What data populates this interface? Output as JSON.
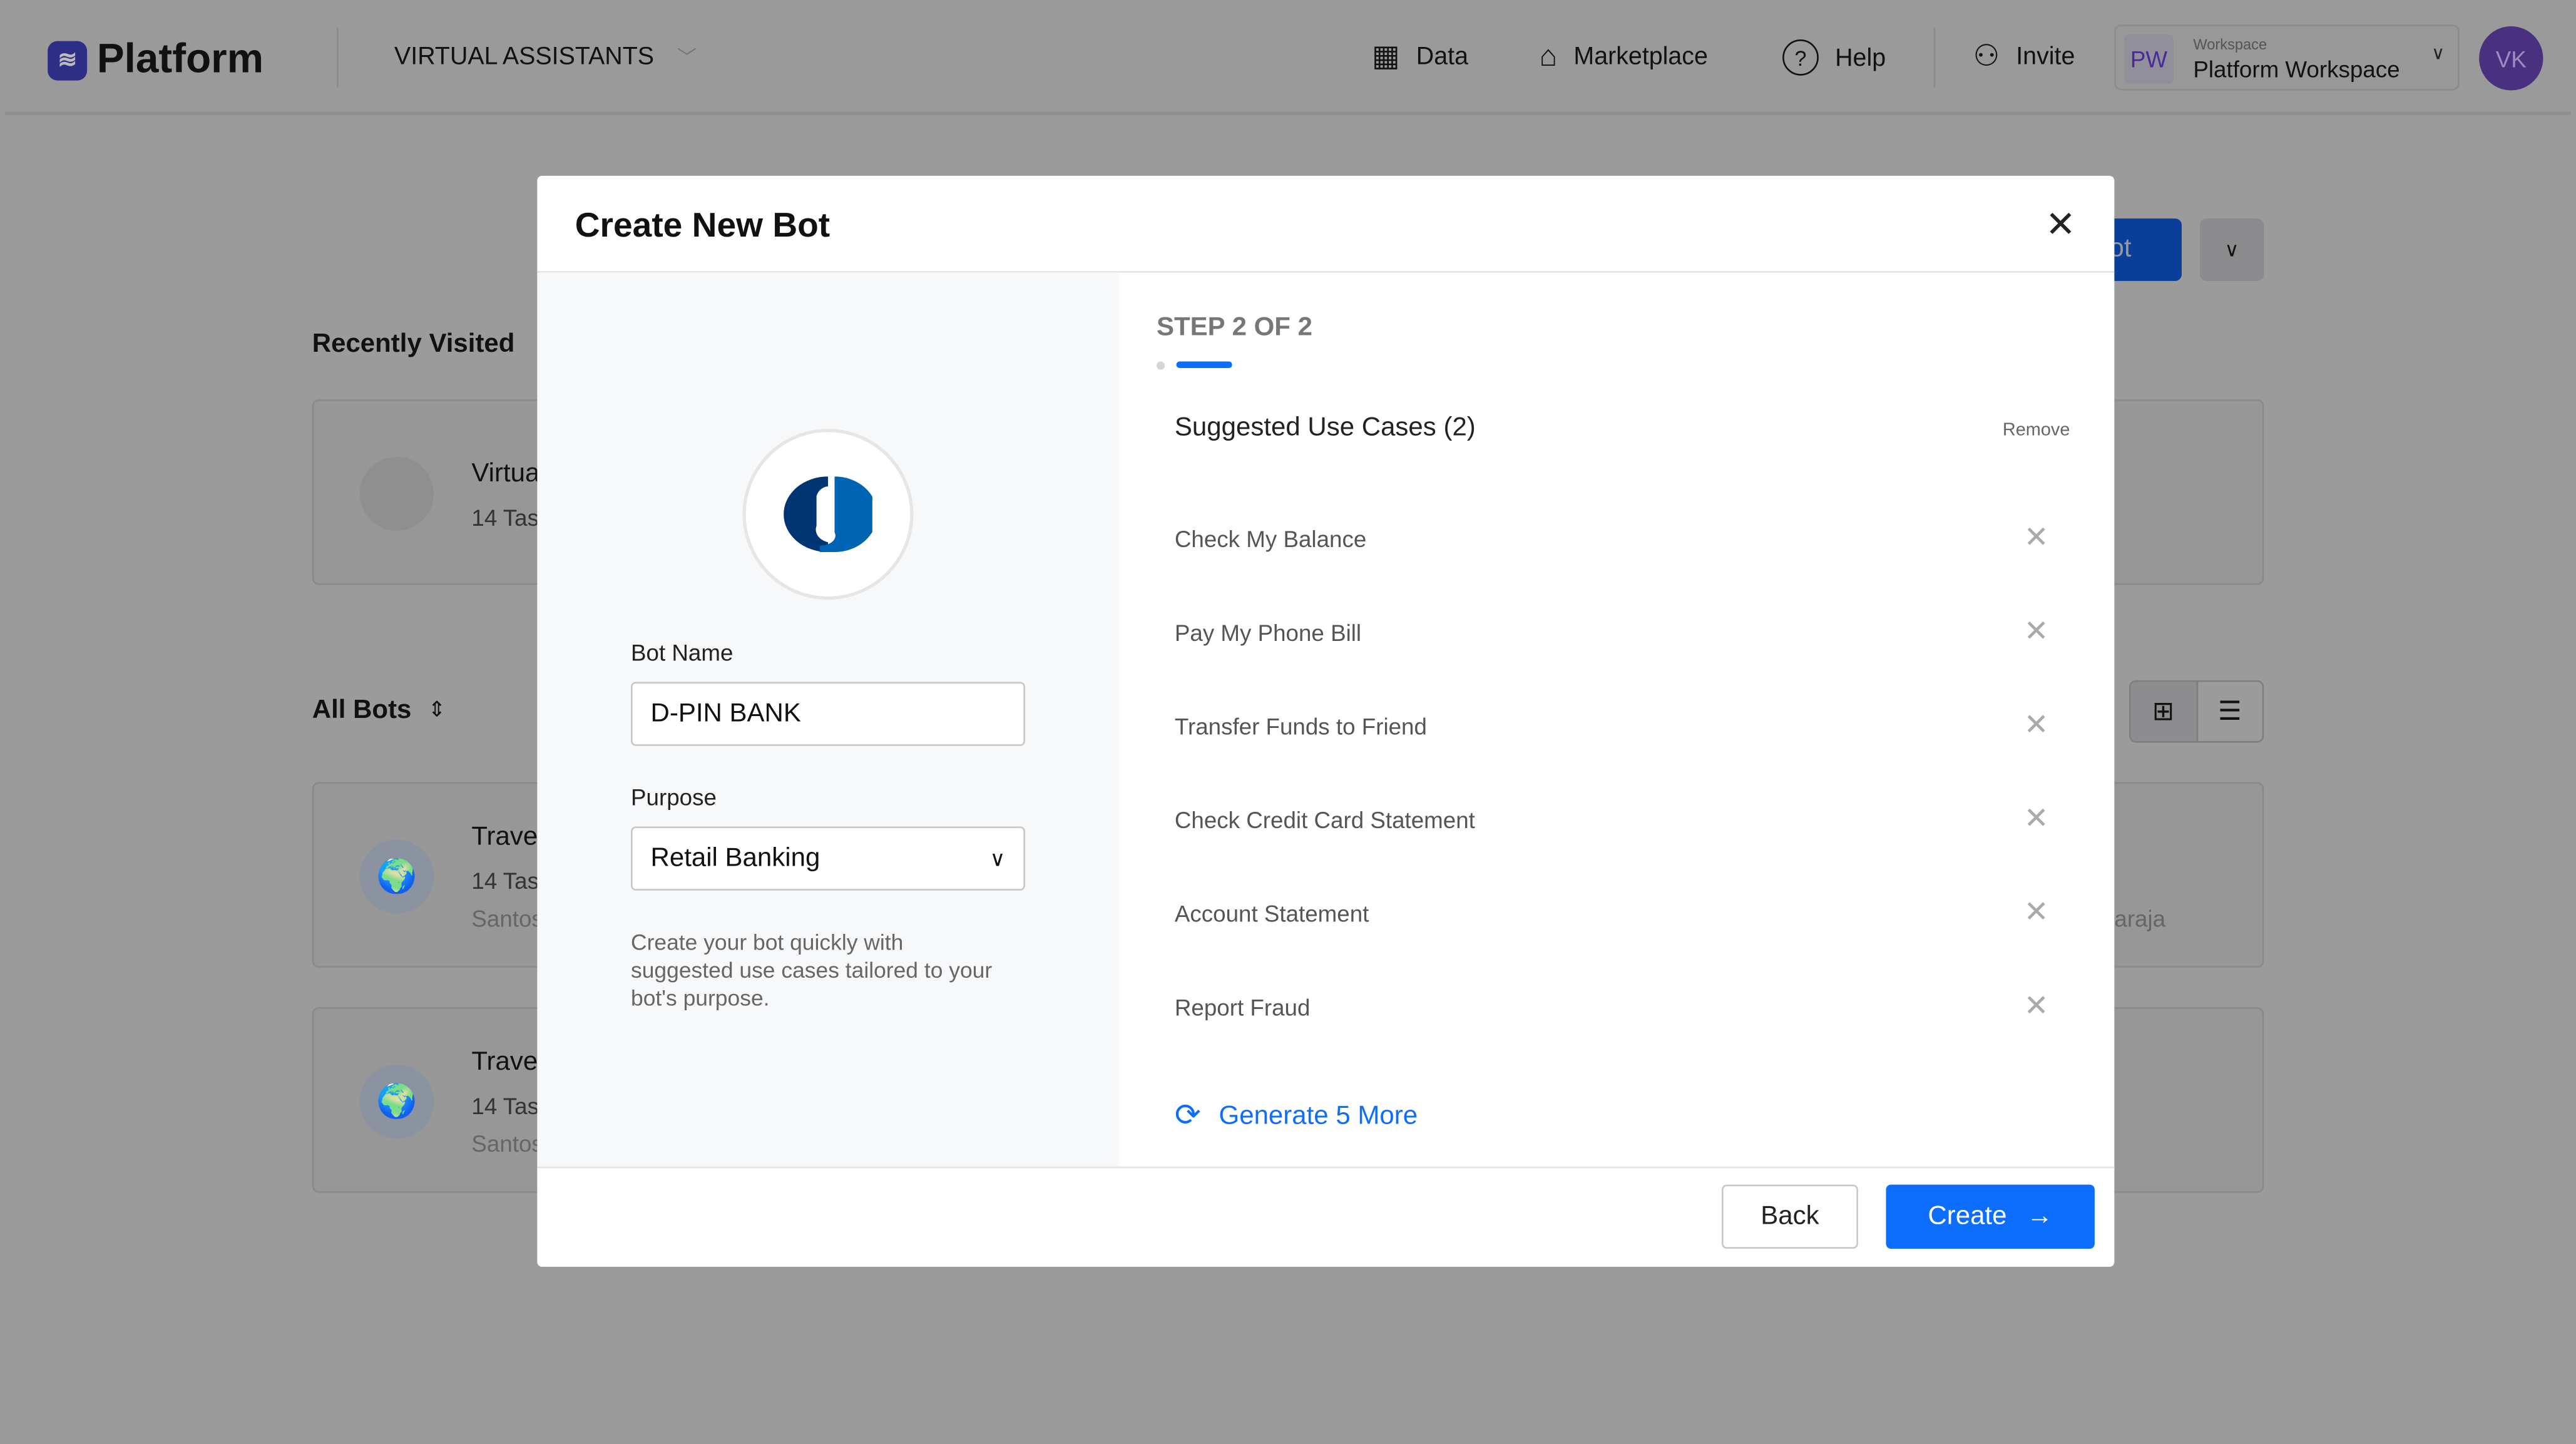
{
  "topbar": {
    "brand": "Platform",
    "section": "VIRTUAL ASSISTANTS",
    "nav": [
      {
        "label": "Data",
        "icon": "table-icon"
      },
      {
        "label": "Marketplace",
        "icon": "basket-icon"
      },
      {
        "label": "Help",
        "icon": "help-circle-icon"
      }
    ],
    "invite": "Invite",
    "workspace": {
      "initials": "PW",
      "caption": "Workspace",
      "name": "Platform Workspace"
    },
    "avatar": "VK"
  },
  "background": {
    "new_bot_fragment": "ot",
    "recently_visited": "Recently Visited",
    "recent_card": {
      "title": "Virtua",
      "sub": "14 Tas"
    },
    "all_bots": "All Bots",
    "bot_cards": [
      {
        "title": "Trave",
        "sub": "14 Tas",
        "owner": "Santos"
      },
      {
        "title": "Trave",
        "sub": "14 Tas",
        "owner": "Santos"
      }
    ],
    "right_fragment": "araja"
  },
  "modal": {
    "title": "Create New Bot",
    "step": "STEP 2 OF 2",
    "bot_name_label": "Bot Name",
    "bot_name_value": "D-PIN BANK",
    "purpose_label": "Purpose",
    "purpose_value": "Retail Banking",
    "hint": "Create your bot quickly with suggested use cases tailored to your bot's purpose.",
    "use_cases_title": "Suggested Use Cases (2)",
    "remove_label": "Remove",
    "use_cases": [
      "Check My Balance",
      "Pay My Phone Bill",
      "Transfer Funds to Friend",
      "Check Credit Card Statement",
      "Account Statement",
      "Report Fraud"
    ],
    "generate_more": "Generate 5 More",
    "back": "Back",
    "create": "Create",
    "accent": "#0d6efd"
  }
}
